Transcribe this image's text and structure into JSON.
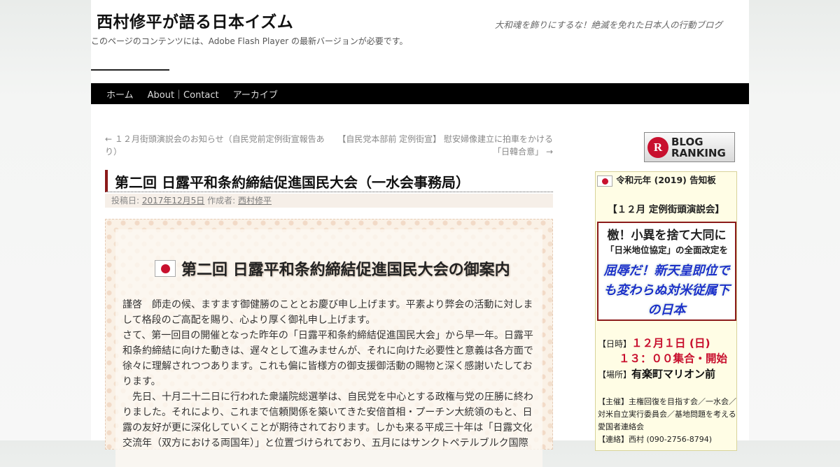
{
  "site": {
    "title": "西村修平が語る日本イズム",
    "description": "大和魂を飾りにするな！絶滅を免れた日本人の行動ブログ",
    "flash_note": "このページのコンテンツには、Adobe Flash Player の最新バージョンが必要です。"
  },
  "nav": {
    "items": [
      {
        "label": "ホーム"
      },
      {
        "label": "About｜Contact"
      },
      {
        "label": "アーカイブ"
      }
    ]
  },
  "post_nav": {
    "prev": "← １２月街頭演説会のお知らせ（自民党前定例街宣報告あり）",
    "next": "【自民党本部前 定例街宣】 慰安婦像建立に拍車をかける「日韓合意」 →"
  },
  "entry": {
    "title": "第二回 日露平和条約締結促進国民大会（一水会事務局）",
    "meta": {
      "posted_label": "投稿日: ",
      "date": "2017年12月5日",
      "author_label": " 作成者: ",
      "author": "西村修平"
    },
    "invite_title": "第二回 日露平和条約締結促進国民大会の御案内",
    "paragraphs": [
      "謹啓　師走の候、ますます御健勝のこととお慶び申し上げます。平素より弊会の活動に対しまして格段のご高配を賜り、心より厚く御礼申し上げます。",
      "さて、第一回目の開催となった昨年の「日露平和条約締結促進国民大会」から早一年。日露平和条約締結に向けた動きは、遅々として進みませんが、それに向けた必要性と意義は各方面で徐々に理解されつつあります。これも偏に皆様方の御支援御活動の賜物と深く感謝いたしております。",
      "　先日、十月二十二日に行われた衆議院総選挙は、自民党を中心とする政権与党の圧勝に終わりました。それにより、これまで信頼関係を築いてきた安倍首相・プーチン大統領のもと、日露の友好が更に深化していくことが期待されております。しかも来る平成三十年は「日露文化交流年（双方における両国年）」と位置づけられており、五月にはサンクトペテルブルク国際"
    ]
  },
  "sidebar": {
    "ranking": {
      "line1": "BLOG",
      "line2": "RANKING",
      "logo": "R"
    },
    "notice": {
      "head": "令和元年 (2019) 告知板",
      "sub": "【１２月 定例街頭演説会】",
      "banner_line1": "檄！小異を捨て大同に",
      "banner_line2": "「日米地位協定」の全面改定を",
      "banner_line3": "屈辱だ！新天皇即位でも変わらぬ対米従属下の日本",
      "date_label": "【日時】",
      "date_value": "１２月１日 (日)",
      "time_value": "１３：００集合・開始",
      "place_label": "【場所】",
      "place_value": "有楽町マリオン前",
      "organizer": "【主催】主権回復を目指す会／一水会／対米自立実行委員会／基地問題を考える愛国者連絡会",
      "contact": "【連絡】西村 (090-2756-8794)"
    }
  }
}
